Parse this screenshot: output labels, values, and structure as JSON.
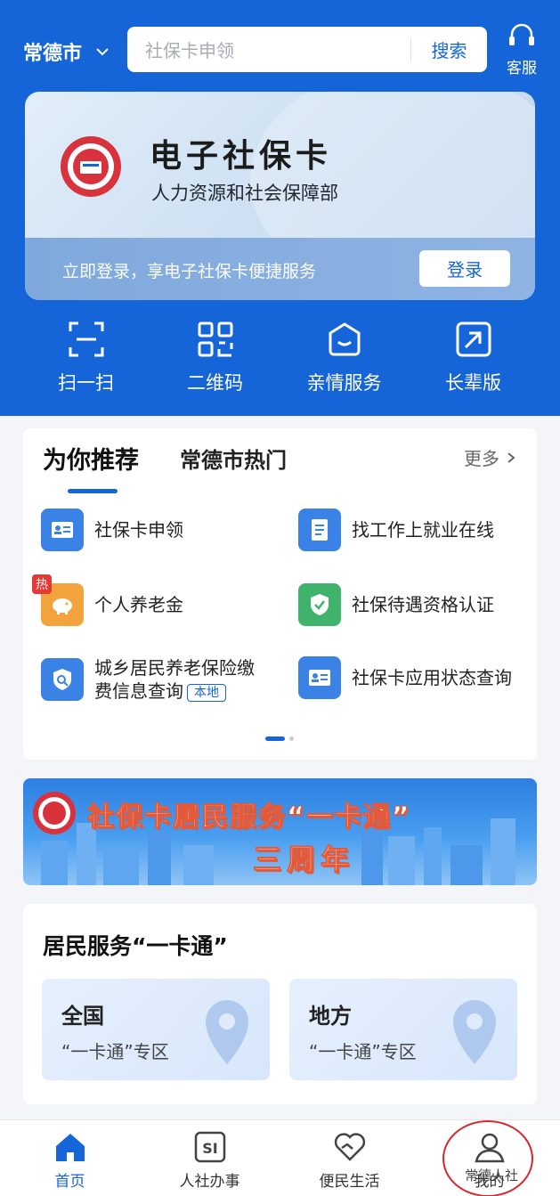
{
  "header": {
    "city": "常德市",
    "search_placeholder": "社保卡申领",
    "search_button": "搜索",
    "service_label": "客服"
  },
  "card": {
    "title": "电子社保卡",
    "subtitle": "人力资源和社会保障部",
    "login_prompt": "立即登录，享电子社保卡便捷服务",
    "login_button": "登录"
  },
  "quick_actions": [
    {
      "label": "扫一扫",
      "icon": "scan-icon"
    },
    {
      "label": "二维码",
      "icon": "qrcode-icon"
    },
    {
      "label": "亲情服务",
      "icon": "family-service-icon"
    },
    {
      "label": "长辈版",
      "icon": "elder-mode-icon"
    }
  ],
  "recommend": {
    "tab_active": "为你推荐",
    "tab_other": "常德市热门",
    "more": "更多",
    "items": [
      {
        "label": "社保卡申领",
        "icon": "id-card-icon"
      },
      {
        "label": "找工作上就业在线",
        "icon": "document-icon"
      },
      {
        "label": "个人养老金",
        "icon": "piggy-bank-icon",
        "badge": "热"
      },
      {
        "label": "社保待遇资格认证",
        "icon": "shield-check-icon"
      },
      {
        "label": "城乡居民养老保险缴",
        "label2": "费信息查询",
        "tag": "本地",
        "icon": "shield-search-icon"
      },
      {
        "label": "社保卡应用状态查询",
        "icon": "id-card-icon"
      }
    ]
  },
  "banner": {
    "line1": "社保卡居民服务“一卡通”",
    "line2": "三周年"
  },
  "one_card": {
    "title": "居民服务“一卡通”",
    "cards": [
      {
        "title": "全国",
        "subtitle": "“一卡通”专区"
      },
      {
        "title": "地方",
        "subtitle": "“一卡通”专区"
      }
    ]
  },
  "bottom_nav": [
    {
      "label": "首页",
      "icon": "home-icon",
      "active": true
    },
    {
      "label": "人社办事",
      "icon": "si-icon"
    },
    {
      "label": "便民生活",
      "icon": "heart-hand-icon"
    },
    {
      "label": "我的",
      "icon": "profile-icon"
    }
  ],
  "watermark": "常德人社",
  "colors": {
    "primary": "#1565d8",
    "hot_badge": "#e53935",
    "highlight_circle": "#d9262b"
  }
}
